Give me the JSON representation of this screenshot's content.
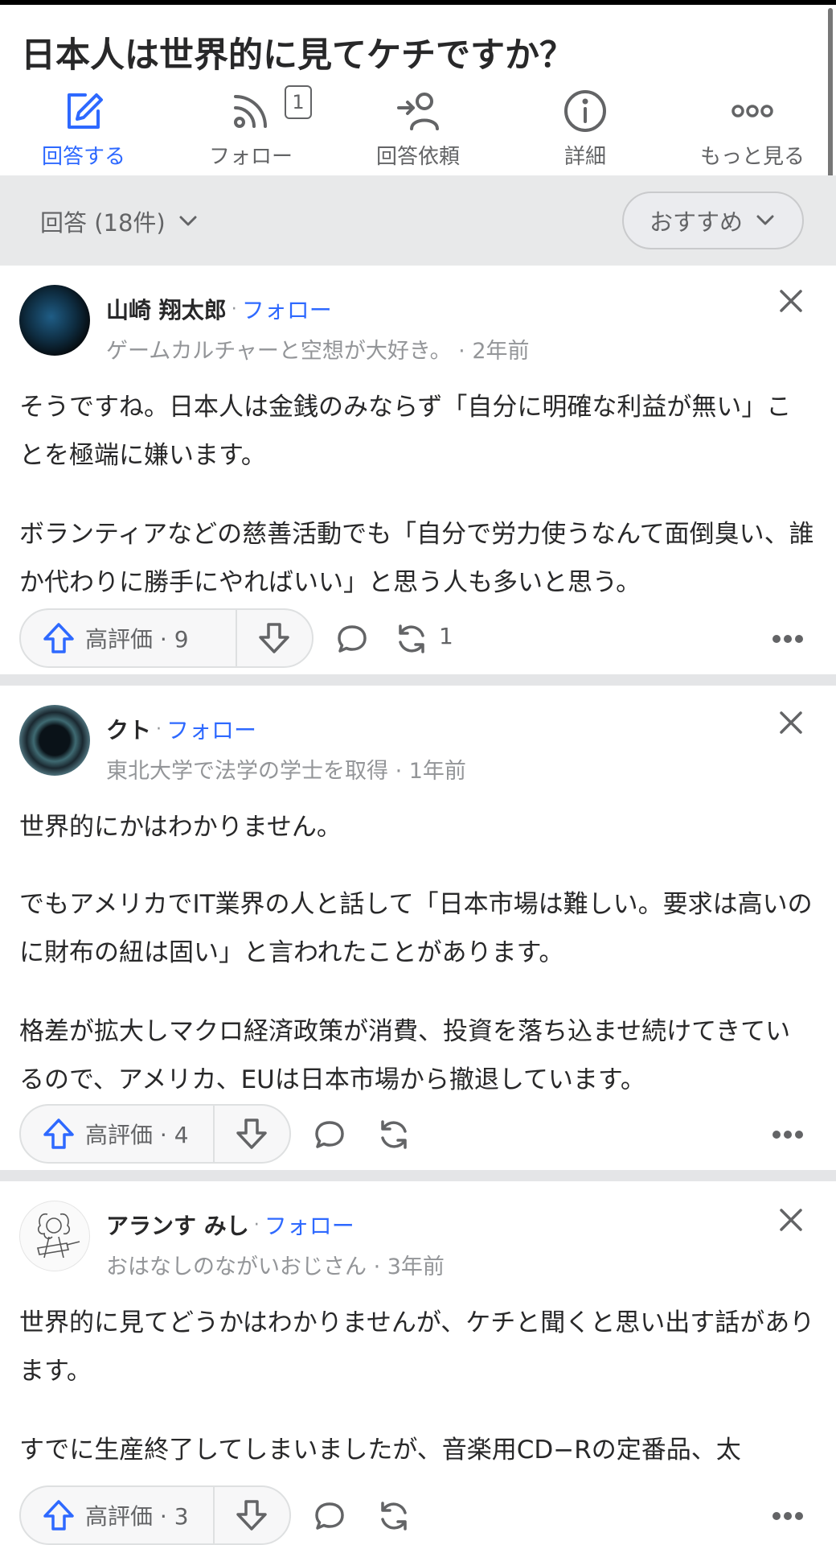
{
  "question": {
    "title": "日本人は世界的に見てケチですか？"
  },
  "actions": [
    {
      "label": "回答する",
      "icon": "pencil-icon",
      "active": true
    },
    {
      "label": "フォロー",
      "icon": "rss-icon",
      "badge": "1"
    },
    {
      "label": "回答依頼",
      "icon": "request-answer-icon"
    },
    {
      "label": "詳細",
      "icon": "info-icon"
    },
    {
      "label": "もっと見る",
      "icon": "more-icon"
    }
  ],
  "filter": {
    "answers_label": "回答 (18件)",
    "sort_label": "おすすめ"
  },
  "answers": [
    {
      "author": "山崎 翔太郎",
      "follow": "フォロー",
      "credential": "ゲームカルチャーと空想が大好き。 · 2年前",
      "paragraphs": [
        "そうですね。日本人は金銭のみならず「自分に明確な利益が無い」ことを極端に嫌います。",
        "ボランティアなどの慈善活動でも「自分で労力使うなんて面倒臭い、誰か代わりに勝手にやればいい」と思う人も多いと思う。"
      ],
      "upvote_label": "高評価 ·  9",
      "share_count": "1"
    },
    {
      "author": "クト",
      "follow": "フォロー",
      "credential": "東北大学で法学の学士を取得 · 1年前",
      "paragraphs": [
        "世界的にかはわかりません。",
        "でもアメリカでIT業界の人と話して「日本市場は難しい。要求は高いのに財布の紐は固い」と言われたことがあります。",
        "格差が拡大しマクロ経済政策が消費、投資を落ち込ませ続けてきているので、アメリカ、EUは日本市場から撤退しています。"
      ],
      "upvote_label": "高評価 · 4"
    },
    {
      "author": "アランす みし",
      "follow": "フォロー",
      "credential": "おはなしのながいおじさん · 3年前",
      "paragraphs": [
        "世界的に見てどうかはわかりませんが、ケチと聞くと思い出す話があります。",
        "すでに生産終了してしまいましたが、音楽用CD−Rの定番品、太"
      ],
      "upvote_label": "高評価 · 3"
    }
  ],
  "colors": {
    "accent": "#2e69ff",
    "text": "#282829",
    "muted": "#636466",
    "light": "#939598"
  }
}
